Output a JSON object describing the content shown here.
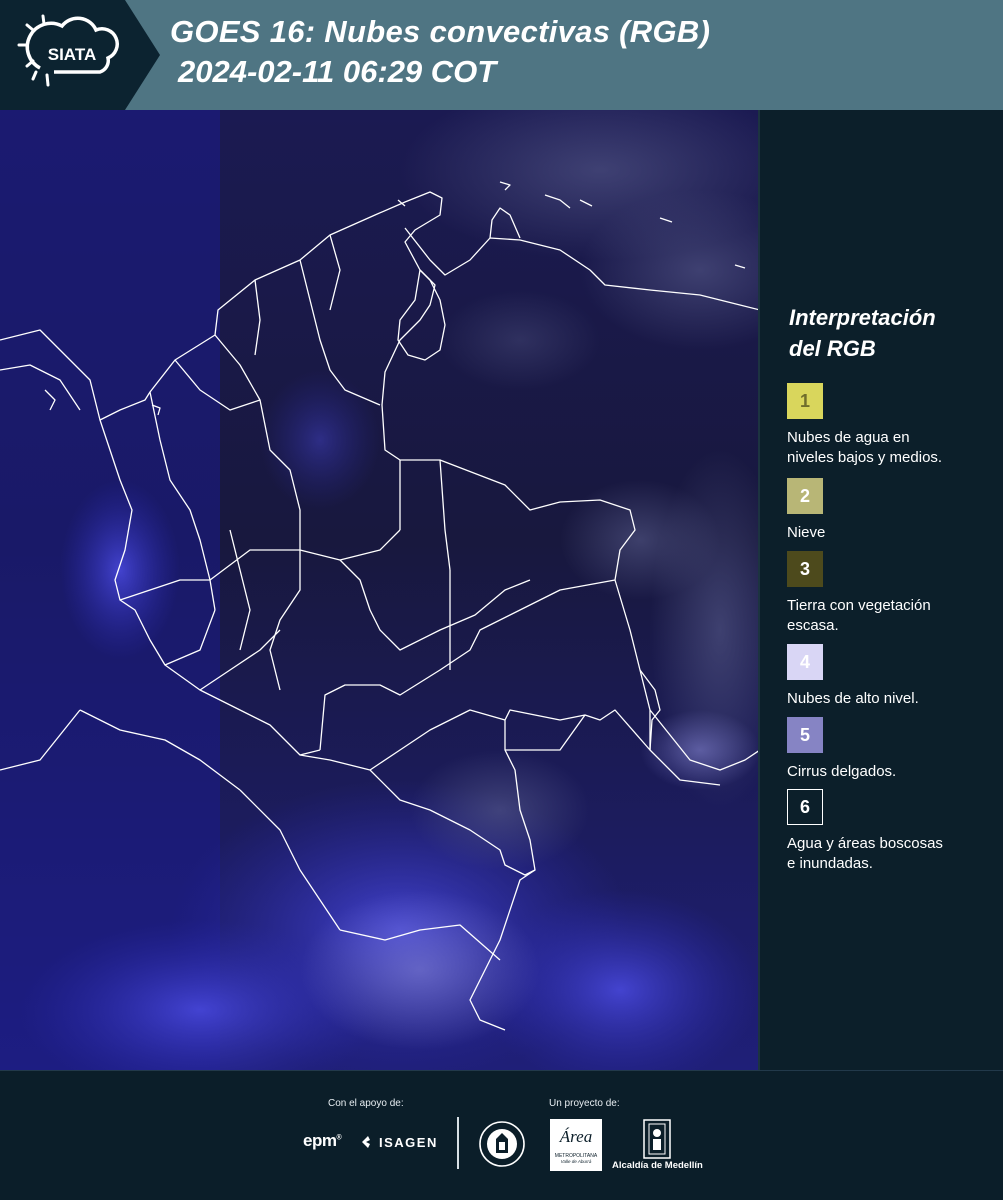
{
  "header": {
    "logo_text": "SIATA",
    "title_line1": "GOES 16: Nubes convectivas (RGB)",
    "title_line2": "2024-02-11 06:29 COT"
  },
  "legend": {
    "title_line1": "Interpretación",
    "title_line2": "del RGB",
    "items": [
      {
        "num": "1",
        "label_lines": [
          "Nubes de agua en",
          "niveles bajos y medios."
        ],
        "color": "#d9d65c",
        "num_color": "#6f6d2c"
      },
      {
        "num": "2",
        "label_lines": [
          "Nieve"
        ],
        "color": "#b8b676",
        "num_color": "#ffffff"
      },
      {
        "num": "3",
        "label_lines": [
          "Tierra con vegetación",
          "escasa."
        ],
        "color": "#4d4a1c",
        "num_color": "#ffffff"
      },
      {
        "num": "4",
        "label_lines": [
          "Nubes de alto nivel."
        ],
        "color": "#d9d6f5",
        "num_color": "#ffffff"
      },
      {
        "num": "5",
        "label_lines": [
          "Cirrus delgados."
        ],
        "color": "#8684c4",
        "num_color": "#ffffff"
      },
      {
        "num": "6",
        "label_lines": [
          "Agua y áreas boscosas",
          "e inundadas."
        ],
        "color": "#0c1f2a",
        "num_color": "#ffffff"
      }
    ]
  },
  "footer": {
    "support_caption": "Con el apoyo de:",
    "project_caption": "Un proyecto de:",
    "sponsor_epm": "epm",
    "sponsor_isagen": "ISAGEN",
    "area_logo_word": "Área",
    "area_subtitle_1": "METROPOLITANA",
    "area_subtitle_2": "Valle de Aburrá",
    "alcaldia": "Alcaldía de Medellín"
  }
}
